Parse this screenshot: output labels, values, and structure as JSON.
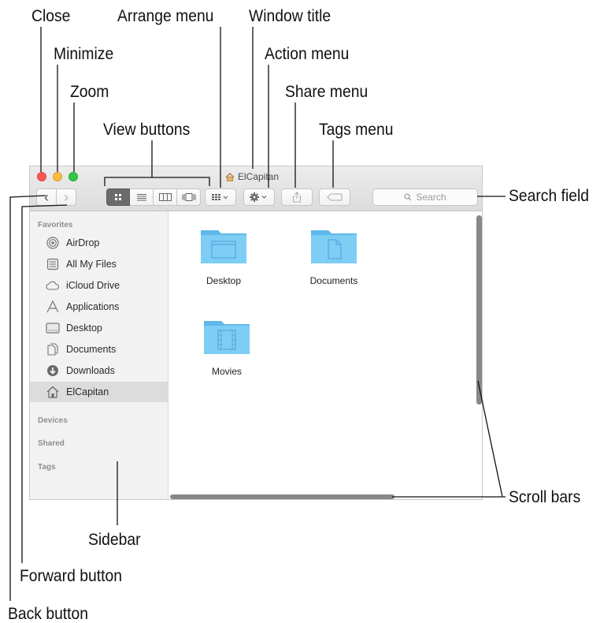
{
  "window": {
    "title": "ElCapitan",
    "search_placeholder": "Search"
  },
  "toolbar": {
    "back_glyph": "‹",
    "forward_glyph": "›"
  },
  "sidebar": {
    "sections": {
      "favorites": "Favorites",
      "devices": "Devices",
      "shared": "Shared",
      "tags": "Tags"
    },
    "items": [
      {
        "label": "AirDrop",
        "icon": "airdrop-icon"
      },
      {
        "label": "All My Files",
        "icon": "all-my-files-icon"
      },
      {
        "label": "iCloud Drive",
        "icon": "cloud-icon"
      },
      {
        "label": "Applications",
        "icon": "applications-icon"
      },
      {
        "label": "Desktop",
        "icon": "desktop-icon"
      },
      {
        "label": "Documents",
        "icon": "documents-icon"
      },
      {
        "label": "Downloads",
        "icon": "downloads-icon"
      },
      {
        "label": "ElCapitan",
        "icon": "home-icon",
        "selected": true
      }
    ]
  },
  "files": [
    {
      "name": "Desktop",
      "icon": "folder-desktop-icon"
    },
    {
      "name": "Documents",
      "icon": "folder-documents-icon"
    },
    {
      "name": "Movies",
      "icon": "folder-movies-icon"
    }
  ],
  "callouts": {
    "close": "Close",
    "minimize": "Minimize",
    "zoom": "Zoom",
    "view_buttons": "View buttons",
    "arrange_menu": "Arrange menu",
    "window_title": "Window title",
    "action_menu": "Action menu",
    "share_menu": "Share menu",
    "tags_menu": "Tags menu",
    "search_field": "Search field",
    "scroll_bars": "Scroll bars",
    "sidebar": "Sidebar",
    "forward_button": "Forward button",
    "back_button": "Back button"
  },
  "colors": {
    "close": "#fc5753",
    "minimize": "#fdbc40",
    "zoom": "#33c748",
    "folder": "#6cc4f0"
  }
}
